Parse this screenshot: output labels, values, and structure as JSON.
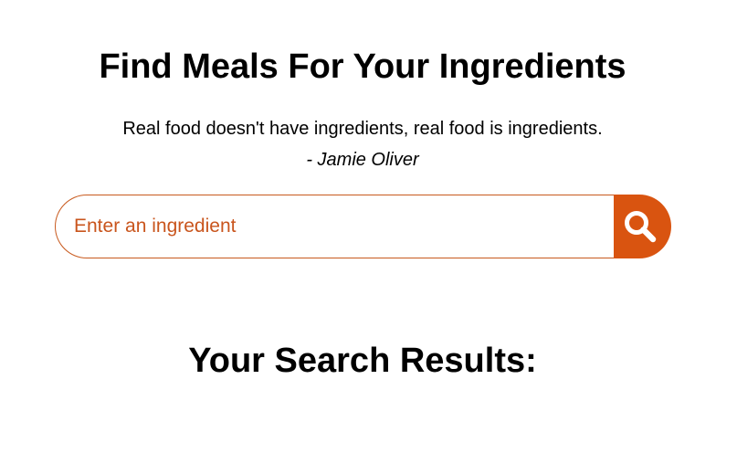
{
  "header": {
    "title": "Find Meals For Your Ingredients",
    "quote": "Real food doesn't have ingredients, real food is ingredients.",
    "author": "- Jamie Oliver"
  },
  "search": {
    "placeholder": "Enter an ingredient",
    "value": "",
    "button_icon": "search-icon"
  },
  "results": {
    "heading": "Your Search Results:"
  },
  "colors": {
    "accent": "#d95410",
    "input_border": "#c85a1e",
    "placeholder": "#c9551d",
    "text": "#000000",
    "background": "#ffffff"
  }
}
